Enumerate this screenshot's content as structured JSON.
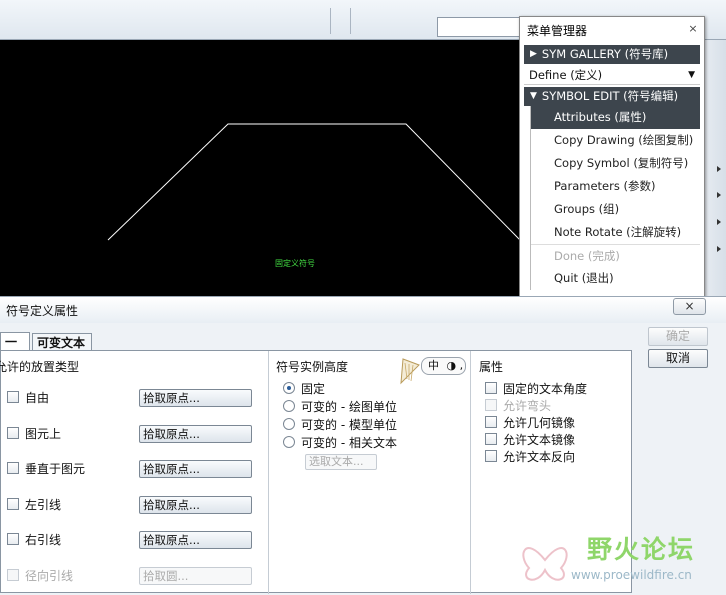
{
  "canvas": {
    "label": "固定义符号"
  },
  "menu": {
    "title": "菜单管理器",
    "close_glyph": "×",
    "header1": "SYM GALLERY (符号库)",
    "define": "Define (定义)",
    "header2": "SYMBOL EDIT (符号编辑)",
    "items": [
      {
        "label": "Attributes (属性)"
      },
      {
        "label": "Copy Drawing (绘图复制)"
      },
      {
        "label": "Copy Symbol (复制符号)"
      },
      {
        "label": "Parameters (参数)"
      },
      {
        "label": "Groups (组)"
      },
      {
        "label": "Note Rotate (注解旋转)"
      },
      {
        "label": "Done (完成)"
      },
      {
        "label": "Quit (退出)"
      }
    ]
  },
  "dialog": {
    "title": "符号定义属性",
    "close_glyph": "×",
    "tabs": [
      "一般",
      "可变文本"
    ],
    "placement": {
      "title": "允许的放置类型",
      "rows": [
        {
          "label": "自由",
          "button": "拾取原点..."
        },
        {
          "label": "图元上",
          "button": "拾取原点..."
        },
        {
          "label": "垂直于图元",
          "button": "拾取原点..."
        },
        {
          "label": "左引线",
          "button": "拾取原点..."
        },
        {
          "label": "右引线",
          "button": "拾取原点..."
        },
        {
          "label": "径向引线",
          "button": "拾取圆..."
        }
      ]
    },
    "height": {
      "title": "符号实例高度",
      "options": [
        "固定",
        "可变的 - 绘图单位",
        "可变的 - 模型单位",
        "可变的 - 相关文本"
      ],
      "select_button": "选取文本..."
    },
    "ime": {
      "text": "中"
    },
    "props": {
      "title": "属性",
      "items": [
        "固定的文本角度",
        "允许弯头",
        "允许几何镜像",
        "允许文本镜像",
        "允许文本反向"
      ]
    },
    "ok": "确定",
    "cancel": "取消"
  },
  "watermark": {
    "name": "野火论坛",
    "url": "www.proewildfire.cn"
  }
}
